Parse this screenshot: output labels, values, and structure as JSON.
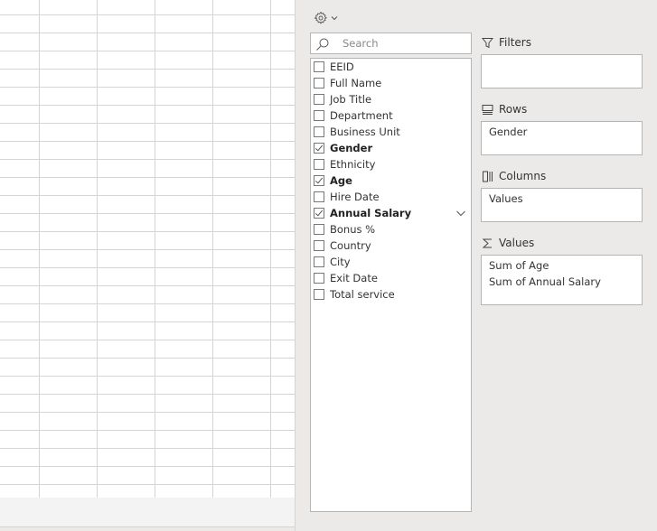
{
  "search": {
    "placeholder": "Search",
    "icon": "search-icon"
  },
  "settings": {
    "icon": "gear-icon"
  },
  "fields": [
    {
      "label": "EEID",
      "checked": false
    },
    {
      "label": "Full Name",
      "checked": false
    },
    {
      "label": "Job Title",
      "checked": false
    },
    {
      "label": "Department",
      "checked": false
    },
    {
      "label": "Business Unit",
      "checked": false
    },
    {
      "label": "Gender",
      "checked": true
    },
    {
      "label": "Ethnicity",
      "checked": false
    },
    {
      "label": "Age",
      "checked": true
    },
    {
      "label": "Hire Date",
      "checked": false
    },
    {
      "label": "Annual Salary",
      "checked": true,
      "dropdown": true
    },
    {
      "label": "Bonus %",
      "checked": false
    },
    {
      "label": "Country",
      "checked": false
    },
    {
      "label": "City",
      "checked": false
    },
    {
      "label": "Exit Date",
      "checked": false
    },
    {
      "label": "Total service",
      "checked": false
    }
  ],
  "areas": {
    "filters": {
      "title": "Filters",
      "items": []
    },
    "rows": {
      "title": "Rows",
      "items": [
        "Gender"
      ]
    },
    "columns": {
      "title": "Columns",
      "items": [
        "Values"
      ]
    },
    "values": {
      "title": "Values",
      "items": [
        "Sum of Age",
        "Sum of Annual Salary"
      ]
    }
  }
}
